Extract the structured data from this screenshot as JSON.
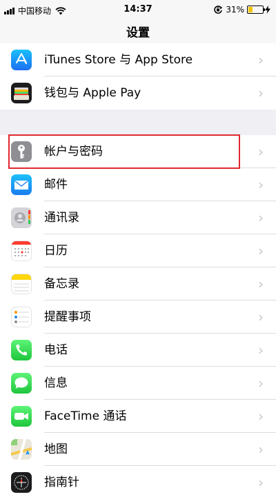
{
  "status_bar": {
    "carrier": "中国移动",
    "time": "14:37",
    "battery": "31%",
    "battery_level": 0.31
  },
  "nav": {
    "title": "设置"
  },
  "groups": [
    {
      "items": [
        {
          "label": "iTunes Store 与 App Store",
          "icon": "app-store-icon",
          "color": "#1e8ef5"
        },
        {
          "label": "钱包与 Apple Pay",
          "icon": "wallet-icon",
          "color": "#1c1c1e"
        }
      ]
    },
    {
      "items": [
        {
          "label": "帐户与密码",
          "icon": "key-icon",
          "color": "#8e8e93"
        },
        {
          "label": "邮件",
          "icon": "mail-icon",
          "color": "#1a8cf0"
        },
        {
          "label": "通讯录",
          "icon": "contacts-icon",
          "color": "#b9b9bd"
        },
        {
          "label": "日历",
          "icon": "calendar-icon",
          "color": "#ffffff"
        },
        {
          "label": "备忘录",
          "icon": "notes-icon",
          "color": "#ffffff"
        },
        {
          "label": "提醒事项",
          "icon": "reminders-icon",
          "color": "#ffffff"
        },
        {
          "label": "电话",
          "icon": "phone-icon",
          "color": "#34c759"
        },
        {
          "label": "信息",
          "icon": "messages-icon",
          "color": "#34c759"
        },
        {
          "label": "FaceTime 通话",
          "icon": "facetime-icon",
          "color": "#34c759"
        },
        {
          "label": "地图",
          "icon": "maps-icon",
          "color": "#e9e6dc"
        },
        {
          "label": "指南针",
          "icon": "compass-icon",
          "color": "#1c1c1e"
        }
      ]
    }
  ]
}
